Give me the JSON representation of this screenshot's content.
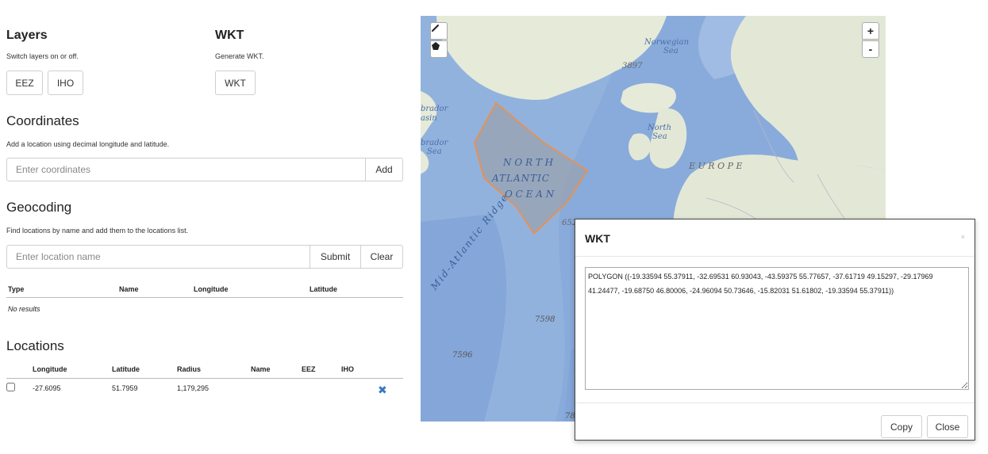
{
  "layers": {
    "title": "Layers",
    "desc": "Switch layers on or off.",
    "eez": "EEZ",
    "iho": "IHO"
  },
  "wkt": {
    "title": "WKT",
    "desc": "Generate WKT.",
    "button": "WKT"
  },
  "coordinates": {
    "title": "Coordinates",
    "desc": "Add a location using decimal longitude and latitude.",
    "placeholder": "Enter coordinates",
    "add": "Add"
  },
  "geocoding": {
    "title": "Geocoding",
    "desc": "Find locations by name and add them to the locations list.",
    "placeholder": "Enter location name",
    "submit": "Submit",
    "clear": "Clear",
    "headers": {
      "type": "Type",
      "name": "Name",
      "longitude": "Longitude",
      "latitude": "Latitude"
    },
    "empty": "No results"
  },
  "locations": {
    "title": "Locations",
    "headers": {
      "longitude": "Longitude",
      "latitude": "Latitude",
      "radius": "Radius",
      "name": "Name",
      "eez": "EEZ",
      "iho": "IHO"
    },
    "rows": [
      {
        "longitude": "-27.6095",
        "latitude": "51.7959",
        "radius": "1,179,295",
        "name": "",
        "eez": "",
        "iho": ""
      }
    ]
  },
  "map": {
    "labels": {
      "norwegian": "Norwegian",
      "sea1": "Sea",
      "north": "North",
      "sea2": "Sea",
      "europe": "E U R O P E",
      "labrador1": "brador",
      "basin": "asin",
      "labrador2": "brador",
      "sea3": "Sea",
      "na_north": "N O R T H",
      "na_atlantic": "ATLANTIC",
      "na_ocean": "O C E A N",
      "ridge": "Mid-Atlantic Ridge",
      "d3897": "3897",
      "d652": "652",
      "d7598": "7598",
      "d7596": "7596",
      "d78": "78"
    },
    "controls": {
      "zoom_in": "+",
      "zoom_out": "-"
    },
    "colors": {
      "ocean": "#89abdb",
      "land": "#e3e8d6",
      "polygon_fill": "#9aa2b0",
      "polygon_stroke": "#e0935a"
    }
  },
  "modal": {
    "title": "WKT",
    "close_x": "×",
    "text": "POLYGON ((-19.33594 55.37911, -32.69531 60.93043, -43.59375 55.77657, -37.61719 49.15297, -29.17969 41.24477, -19.68750 46.80006, -24.96094 50.73646, -15.82031 51.61802, -19.33594 55.37911))",
    "copy": "Copy",
    "close": "Close"
  }
}
